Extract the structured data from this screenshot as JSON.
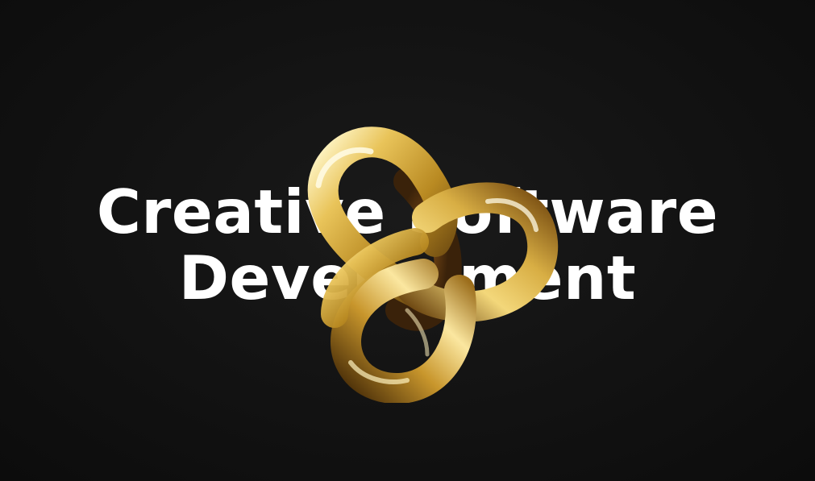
{
  "hero": {
    "headline": {
      "line1": "Creative Software",
      "line2": "Development"
    },
    "graphic": {
      "icon": "gold-trefoil-knot",
      "colors": {
        "highlight": "#fff6c8",
        "gold_light": "#e9c45a",
        "gold_mid": "#b98a22",
        "gold_dark": "#5a3a0c",
        "copper_shadow": "#3a220a"
      }
    },
    "background_color": "#111111",
    "text_color": "#ffffff"
  }
}
